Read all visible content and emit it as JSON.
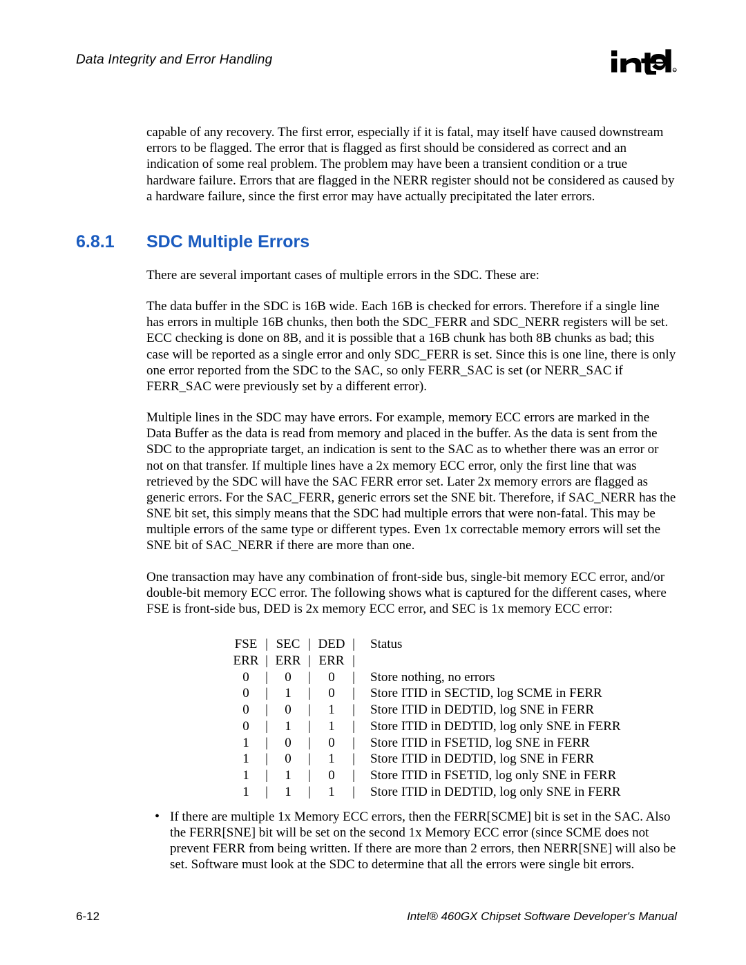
{
  "header": {
    "title": "Data Integrity and Error Handling",
    "logo_name": "intel-logo"
  },
  "intro_paragraph": "capable of any recovery.  The first error, especially if it is fatal, may itself have caused downstream errors to be flagged.  The error that is flagged as first should be considered as correct and an indication of some real problem.  The problem may have been a transient condition or a true hardware failure.  Errors that are flagged in the NERR register should not be considered as caused by a hardware failure, since the first error may have actually precipitated the later errors.",
  "section": {
    "number": "6.8.1",
    "title": "SDC Multiple Errors"
  },
  "paragraphs": [
    "There are several important cases of multiple errors in the SDC.  These are:",
    "The data buffer in the SDC is 16B wide.  Each 16B is checked for errors.  Therefore if a single line has errors in multiple 16B chunks, then both the SDC_FERR and SDC_NERR registers will be set.  ECC checking is done on 8B, and it is possible that a 16B chunk has both 8B chunks as bad; this case will be reported as a single error and only SDC_FERR is set.  Since this is one line, there is only one error reported from the SDC to the SAC, so only FERR_SAC is set (or NERR_SAC if FERR_SAC were previously set by a different error).",
    "Multiple lines in the SDC may have errors.  For example, memory ECC errors are marked in the Data Buffer as the data is read from memory and placed in the buffer. As the data is sent from the SDC to the appropriate target, an indication is sent to the SAC as to whether there was an error or not on that transfer.  If multiple lines have a 2x memory ECC error, only the first line that was retrieved by the SDC will have the SAC FERR error set.  Later 2x memory errors are flagged as generic errors.  For the SAC_FERR, generic errors set the SNE bit.  Therefore, if SAC_NERR has the SNE bit set, this simply means that the SDC had multiple errors that were non-fatal. This may be multiple errors of the same type or different types.  Even 1x correctable memory errors will set the SNE bit of SAC_NERR if there are more than one.",
    "One transaction may have any combination of front-side bus, single-bit memory ECC error, and/or double-bit memory ECC error.  The following shows what is captured for the different cases, where FSE is front-side bus, DED is 2x memory ECC error, and SEC is 1x memory ECC error:"
  ],
  "table": {
    "head1": {
      "fse": "FSE",
      "sec": "SEC",
      "ded": "DED",
      "status": "Status"
    },
    "head2": {
      "fse": "ERR",
      "sec": "ERR",
      "ded": "ERR",
      "status": ""
    },
    "rows": [
      {
        "fse": "0",
        "sec": "0",
        "ded": "0",
        "status": "Store nothing, no errors"
      },
      {
        "fse": "0",
        "sec": "1",
        "ded": "0",
        "status": "Store ITID in SECTID, log SCME in FERR"
      },
      {
        "fse": "0",
        "sec": "0",
        "ded": "1",
        "status": "Store ITID in DEDTID, log SNE in FERR"
      },
      {
        "fse": "0",
        "sec": "1",
        "ded": "1",
        "status": "Store ITID in DEDTID, log only SNE in FERR"
      },
      {
        "fse": "1",
        "sec": "0",
        "ded": "0",
        "status": "Store ITID in FSETID, log SNE in FERR"
      },
      {
        "fse": "1",
        "sec": "0",
        "ded": "1",
        "status": "Store ITID in DEDTID, log SNE in FERR"
      },
      {
        "fse": "1",
        "sec": "1",
        "ded": "0",
        "status": "Store ITID in FSETID, log only SNE in FERR"
      },
      {
        "fse": "1",
        "sec": "1",
        "ded": "1",
        "status": "Store ITID in DEDTID, log only SNE in FERR"
      }
    ]
  },
  "bullet": "If there are multiple 1x Memory ECC errors, then the FERR[SCME] bit is set in the SAC.  Also the FERR[SNE] bit will be set on the second 1x Memory ECC error (since SCME does not prevent FERR from being written.  If there are more than 2 errors, then NERR[SNE] will also be set.  Software must look at the SDC to determine that all the errors were single bit errors.",
  "footer": {
    "left": "6-12",
    "right": "Intel® 460GX Chipset Software Developer's Manual"
  }
}
